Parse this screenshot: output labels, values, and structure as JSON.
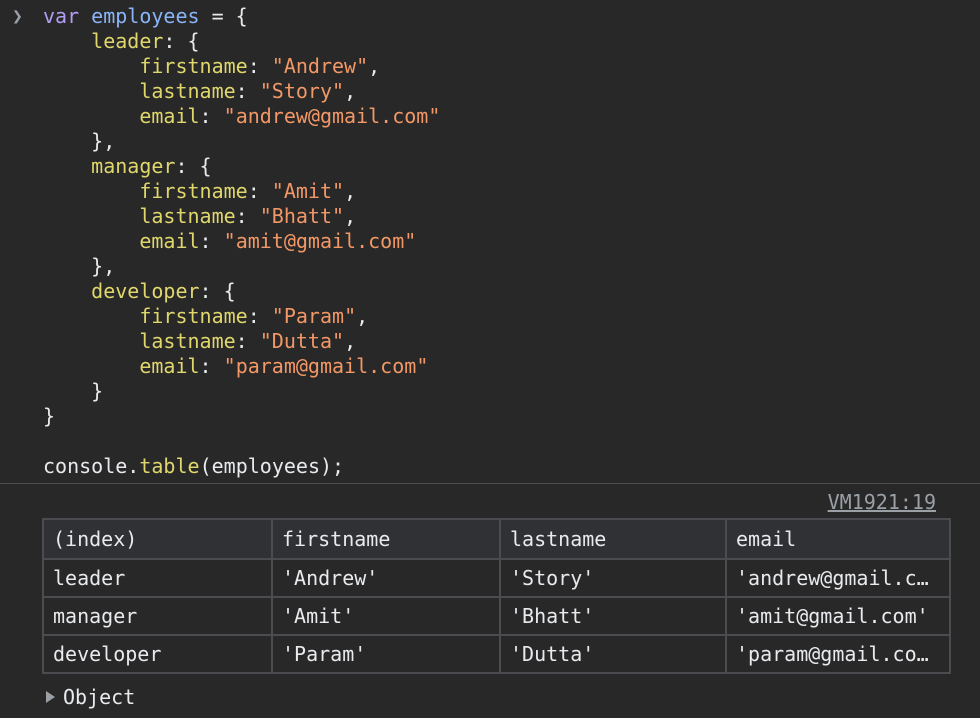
{
  "input": {
    "keyword": "var",
    "var_name": "employees",
    "employees": [
      {
        "key": "leader",
        "firstname": "Andrew",
        "lastname": "Story",
        "email": "andrew@gmail.com"
      },
      {
        "key": "manager",
        "firstname": "Amit",
        "lastname": "Bhatt",
        "email": "amit@gmail.com"
      },
      {
        "key": "developer",
        "firstname": "Param",
        "lastname": "Dutta",
        "email": "param@gmail.com"
      }
    ],
    "call_object": "console",
    "call_method": "table",
    "call_arg": "employees"
  },
  "output": {
    "source_link": "VM1921:19",
    "columns": [
      "(index)",
      "firstname",
      "lastname",
      "email"
    ],
    "rows": [
      {
        "index": "leader",
        "firstname": "'Andrew'",
        "lastname": "'Story'",
        "email": "'andrew@gmail.com'"
      },
      {
        "index": "manager",
        "firstname": "'Amit'",
        "lastname": "'Bhatt'",
        "email": "'amit@gmail.com'"
      },
      {
        "index": "developer",
        "firstname": "'Param'",
        "lastname": "'Dutta'",
        "email": "'param@gmail.com'"
      }
    ],
    "object_label": "Object"
  },
  "colors": {
    "background": "#282828",
    "keyword": "#b39df3",
    "identifier": "#8ab4f8",
    "property": "#e0d76c",
    "string": "#f29766",
    "table_string": "#5fd7c6"
  }
}
